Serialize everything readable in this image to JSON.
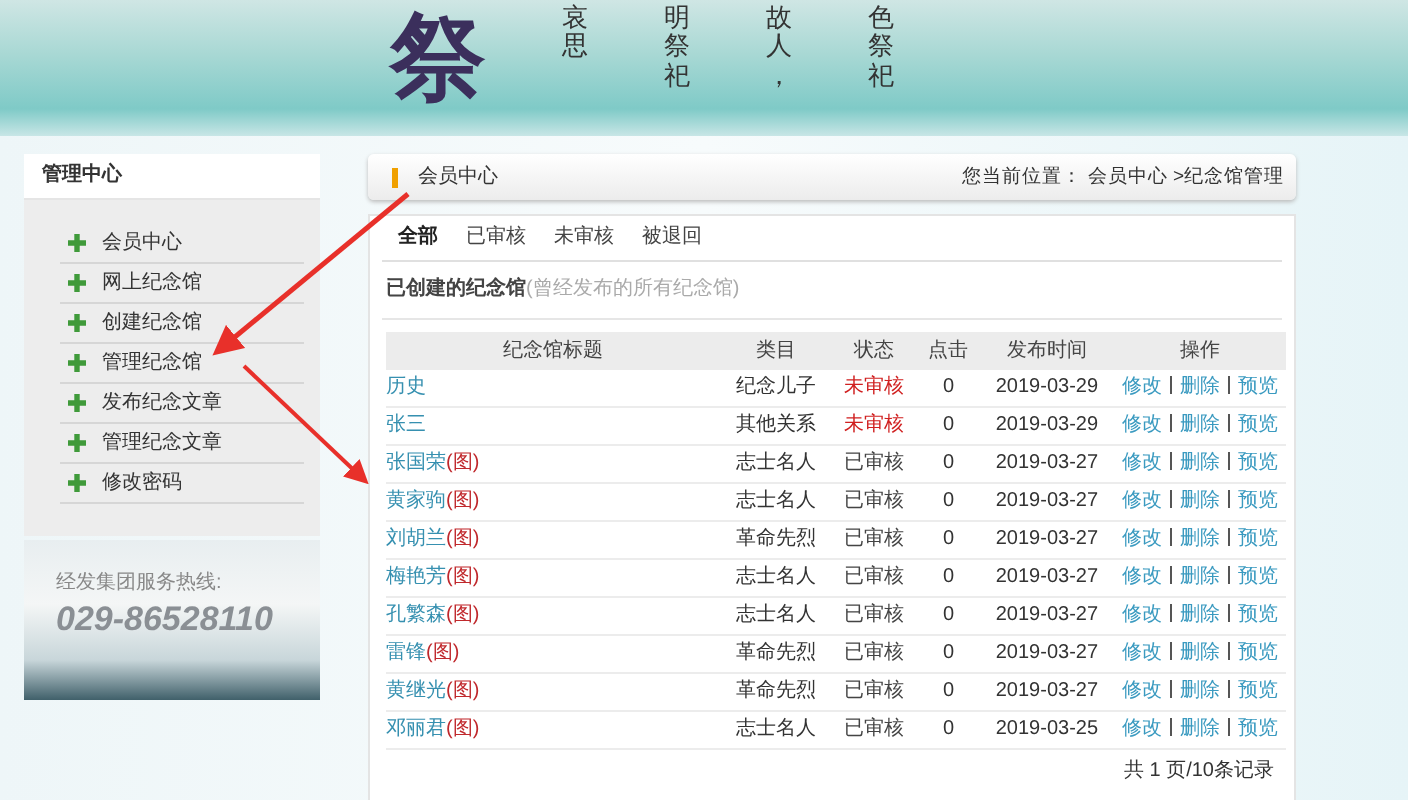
{
  "banner": {
    "title_char": "祭",
    "verses": [
      "哀思",
      "明祭祀",
      "故人，",
      "色祭祀"
    ]
  },
  "sidebar": {
    "title": "管理中心",
    "items": [
      {
        "label": "会员中心"
      },
      {
        "label": "网上纪念馆"
      },
      {
        "label": "创建纪念馆"
      },
      {
        "label": "管理纪念馆"
      },
      {
        "label": "发布纪念文章"
      },
      {
        "label": "管理纪念文章"
      },
      {
        "label": "修改密码"
      }
    ],
    "hotline_label": "经发集团服务热线:",
    "hotline_number": "029-86528110"
  },
  "header": {
    "title": "会员中心",
    "breadcrumb": "您当前位置： 会员中心 >纪念馆管理"
  },
  "tabs": [
    {
      "label": "全部",
      "selected": true
    },
    {
      "label": "已审核",
      "selected": false
    },
    {
      "label": "未审核",
      "selected": false
    },
    {
      "label": "被退回",
      "selected": false
    }
  ],
  "section": {
    "title": "已创建的纪念馆",
    "note": "(曾经发布的所有纪念馆)"
  },
  "table": {
    "columns": [
      "纪念馆标题",
      "类目",
      "状态",
      "点击",
      "发布时间",
      "操作"
    ],
    "rows": [
      {
        "title": "历史",
        "photo_tag": null,
        "category": "纪念儿子",
        "status": "未审核",
        "approved": false,
        "clicks": "0",
        "date": "2019-03-29",
        "actions": [
          "修改",
          "删除",
          "预览"
        ]
      },
      {
        "title": "张三",
        "photo_tag": null,
        "category": "其他关系",
        "status": "未审核",
        "approved": false,
        "clicks": "0",
        "date": "2019-03-29",
        "actions": [
          "修改",
          "删除",
          "预览"
        ]
      },
      {
        "title": "张国荣",
        "photo_tag": "(图)",
        "category": "志士名人",
        "status": "已审核",
        "approved": true,
        "clicks": "0",
        "date": "2019-03-27",
        "actions": [
          "修改",
          "删除",
          "预览"
        ]
      },
      {
        "title": "黄家驹",
        "photo_tag": "(图)",
        "category": "志士名人",
        "status": "已审核",
        "approved": true,
        "clicks": "0",
        "date": "2019-03-27",
        "actions": [
          "修改",
          "删除",
          "预览"
        ]
      },
      {
        "title": "刘胡兰",
        "photo_tag": "(图)",
        "category": "革命先烈",
        "status": "已审核",
        "approved": true,
        "clicks": "0",
        "date": "2019-03-27",
        "actions": [
          "修改",
          "删除",
          "预览"
        ]
      },
      {
        "title": "梅艳芳",
        "photo_tag": "(图)",
        "category": "志士名人",
        "status": "已审核",
        "approved": true,
        "clicks": "0",
        "date": "2019-03-27",
        "actions": [
          "修改",
          "删除",
          "预览"
        ]
      },
      {
        "title": "孔繁森",
        "photo_tag": "(图)",
        "category": "志士名人",
        "status": "已审核",
        "approved": true,
        "clicks": "0",
        "date": "2019-03-27",
        "actions": [
          "修改",
          "删除",
          "预览"
        ]
      },
      {
        "title": "雷锋",
        "photo_tag": "(图)",
        "category": "革命先烈",
        "status": "已审核",
        "approved": true,
        "clicks": "0",
        "date": "2019-03-27",
        "actions": [
          "修改",
          "删除",
          "预览"
        ]
      },
      {
        "title": "黄继光",
        "photo_tag": "(图)",
        "category": "革命先烈",
        "status": "已审核",
        "approved": true,
        "clicks": "0",
        "date": "2019-03-27",
        "actions": [
          "修改",
          "删除",
          "预览"
        ]
      },
      {
        "title": "邓丽君",
        "photo_tag": "(图)",
        "category": "志士名人",
        "status": "已审核",
        "approved": true,
        "clicks": "0",
        "date": "2019-03-25",
        "actions": [
          "修改",
          "删除",
          "预览"
        ]
      }
    ]
  },
  "pagination": "共 1 页/10条记录"
}
